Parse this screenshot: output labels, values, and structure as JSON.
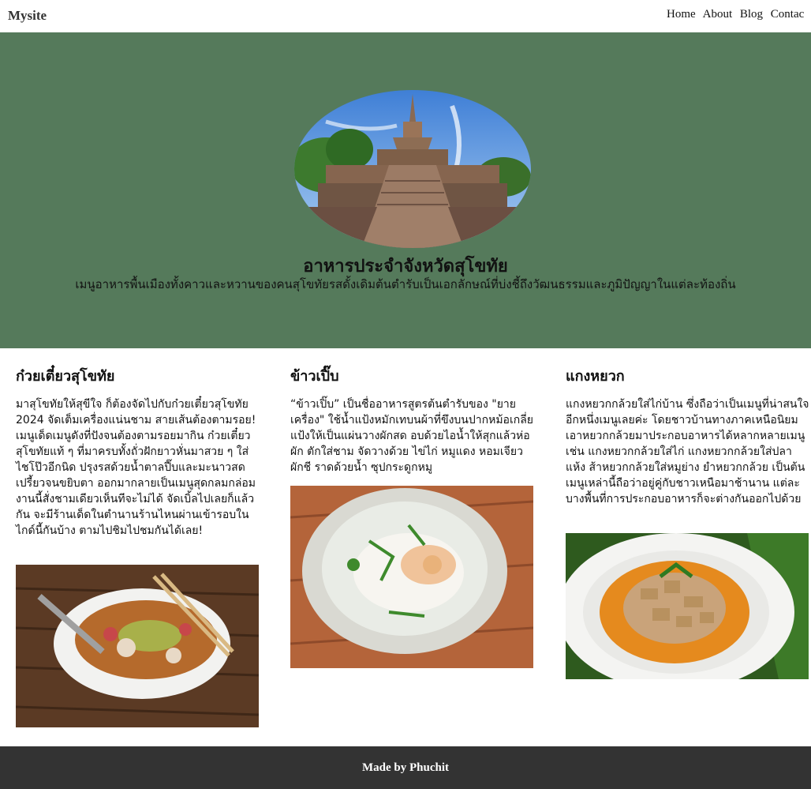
{
  "nav": {
    "brand": "Mysite",
    "links": [
      "Home",
      "About",
      "Blog",
      "Contac"
    ]
  },
  "hero": {
    "title": "อาหารประจำจังหวัดสุโขทัย",
    "subtitle": "เมนูอาหารพื้นเมืองทั้งคาวและหวานของคนสุโขทัยรสดั้งเดิมต้นตำรับเป็นเอกลักษณ์ที่บ่งชี้ถึงวัฒนธรรมและภูมิปัญญาในแต่ละท้องถิ่น"
  },
  "cards": [
    {
      "title": "ก๋วยเตี๋ยวสุโขทัย",
      "text": "มาสุโขทัยให้สุขีใจ ก็ต้องจัดไปกับก๋วยเตี๋ยวสุโขทัย 2024 จัดเต็มเครื่องแน่นชาม สายเส้นต้องตามรอย! เมนูเด็ดเมนูดังที่ปังจนต้องตามรอยมากิน ก๋วยเตี๋ยวสุโขทัยแท้ ๆ ที่มาครบทั้งถั่วฝักยาวหั่นมาสวย ๆ ใส่ไชโป๊วอีกนิด ปรุงรสด้วยน้ำตาลปี๊บและมะนาวสดเปรี้ยวจนขยิบตา ออกมากลายเป็นเมนูสุดกลมกล่อม งานนี้สั่งชามเดียวเห็นทีจะไม่ได้ จัดเบิ้ลไปเลยก็แล้วกัน จะมีร้านเด็ดในตำนานร้านไหนผ่านเข้ารอบในไกด์นี้กันบ้าง ตามไปชิมไปชมกันได้เลย!"
    },
    {
      "title": "ข้าวเปิ๊บ",
      "text": "“ข้าวเปิ๊บ” เป็นชื่ออาหารสูตรต้นตำรับของ \"ยายเครื่อง\" ใช้น้ำแป้งหมักเทบนผ้าที่ขึงบนปากหม้อเกลี่ยแป้งให้เป็นแผ่นวางผักสด อบด้วยไอน้ำให้สุกแล้วห่อผัก ตักใส่ชาม จัดวางด้วย ไข่ไก่ หมูแดง หอมเจียว ผักชี ราดด้วยน้ำ ซุปกระดูกหมู"
    },
    {
      "title": "แกงหยวก",
      "text": "แกงหยวกกล้วยใส่ไก่บ้าน ซึ่งถือว่าเป็นเมนูที่น่าสนใจอีกหนึ่งเมนูเลยค่ะ โดยชาวบ้านทางภาคเหนือนิยมเอาหยวกกล้วยมาประกอบอาหารได้หลากหลายเมนู เช่น แกงหยวกกล้วยใส่ไก่ แกงหยวกกล้วยใส่ปลาแห้ง ส้าหยวกกล้วยใส่หมูย่าง ยำหยวกกล้วย เป็นต้น เมนูเหล่านี้ถือว่าอยู่คู่กับชาวเหนือมาช้านาน แต่ละบางพื้นที่การประกอบอาหารก็จะต่างกันออกไปด้วย"
    }
  ],
  "footer": {
    "text": "Made by Phuchit"
  }
}
